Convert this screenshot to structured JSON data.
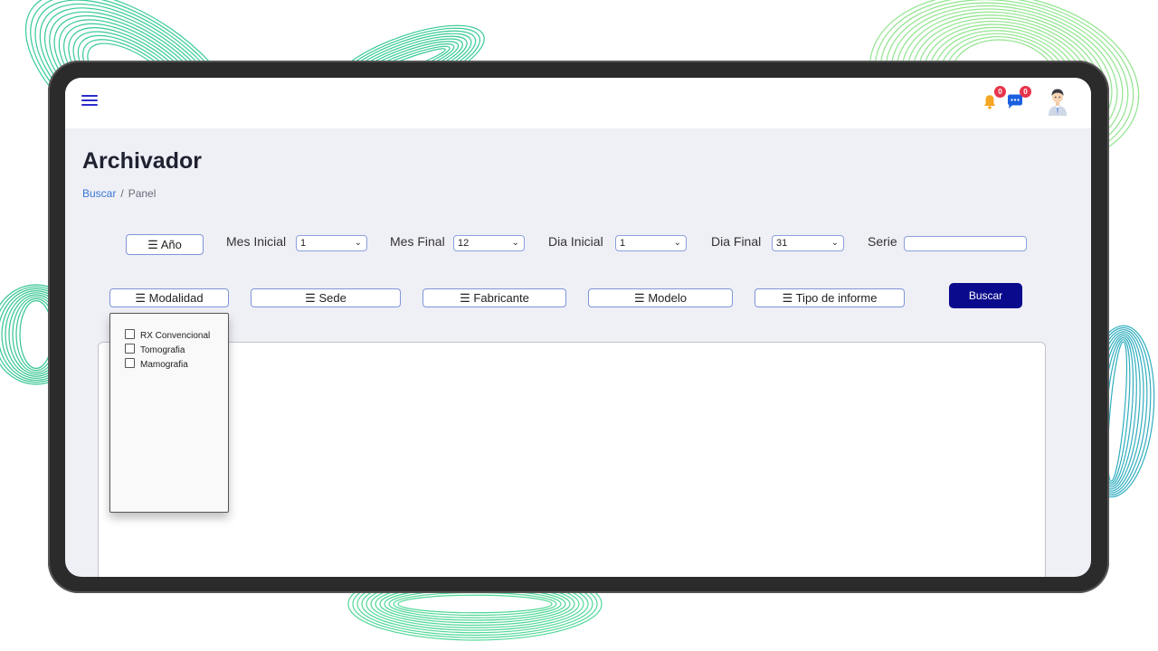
{
  "header": {
    "notifications": {
      "icon": "bell-icon",
      "count": "0"
    },
    "messages": {
      "icon": "chat-icon",
      "count": "0"
    },
    "menu_icon": "hamburger-icon",
    "avatar_icon": "user-avatar"
  },
  "page": {
    "title": "Archivador",
    "breadcrumb": {
      "link": "Buscar",
      "separator": "/",
      "current": "Panel"
    }
  },
  "filters": {
    "year_button": "☰ Año",
    "mes_inicial": {
      "label": "Mes Inicial",
      "value": "1"
    },
    "mes_final": {
      "label": "Mes Final",
      "value": "12"
    },
    "dia_inicial": {
      "label": "Dia Inicial",
      "value": "1"
    },
    "dia_final": {
      "label": "Dia Final",
      "value": "31"
    },
    "serie": {
      "label": "Serie",
      "value": ""
    },
    "modalidad": "☰ Modalidad",
    "sede": "☰ Sede",
    "fabricante": "☰ Fabricante",
    "modelo": "☰ Modelo",
    "tipo_informe": "☰ Tipo  de  informe",
    "buscar": "Buscar"
  },
  "modalidad_dropdown": {
    "options": [
      "RX Convencional",
      "Tomografia",
      "Mamografia"
    ]
  },
  "colors": {
    "accent": "#0a0a8c",
    "link": "#3a78d6",
    "badge": "#e8344b",
    "bell": "#f5a623",
    "chat": "#1b5fe0",
    "wave_left": "#22c58a",
    "wave_right": "#7de07a",
    "wave_teal": "#1aa5b8"
  }
}
